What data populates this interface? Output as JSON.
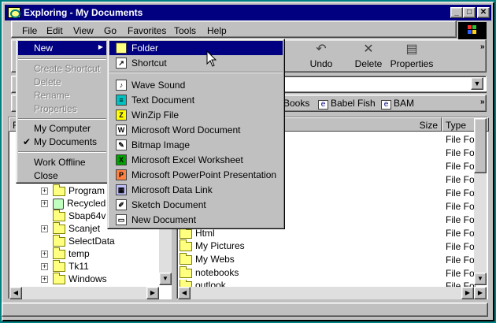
{
  "window": {
    "title": "Exploring - My Documents",
    "buttons": {
      "minimize": "_",
      "maximize": "□",
      "close": "✕"
    }
  },
  "menubar": [
    "File",
    "Edit",
    "View",
    "Go",
    "Favorites",
    "Tools",
    "Help"
  ],
  "toolbar": {
    "undo": "Undo",
    "delete": "Delete",
    "properties": "Properties"
  },
  "links": [
    "Books",
    "Babel Fish",
    "BAM"
  ],
  "columns": {
    "size": "Size",
    "type": "Type"
  },
  "file_menu": {
    "new": "New",
    "create_shortcut": "Create Shortcut",
    "delete": "Delete",
    "rename": "Rename",
    "properties": "Properties",
    "my_computer": "My Computer",
    "my_documents": "My Documents",
    "work_offline": "Work Offline",
    "close": "Close",
    "checkmark": "✔"
  },
  "new_submenu": [
    {
      "label": "Folder",
      "icon": "folder-icon"
    },
    {
      "label": "Shortcut",
      "icon": "shortcut-icon"
    },
    {
      "label": "Wave Sound",
      "icon": "wave-sound-icon"
    },
    {
      "label": "Text Document",
      "icon": "text-document-icon"
    },
    {
      "label": "WinZip File",
      "icon": "winzip-icon"
    },
    {
      "label": "Microsoft Word Document",
      "icon": "word-icon"
    },
    {
      "label": "Bitmap Image",
      "icon": "bitmap-icon"
    },
    {
      "label": "Microsoft Excel Worksheet",
      "icon": "excel-icon"
    },
    {
      "label": "Microsoft PowerPoint Presentation",
      "icon": "powerpoint-icon"
    },
    {
      "label": "Microsoft Data Link",
      "icon": "data-link-icon"
    },
    {
      "label": "Sketch Document",
      "icon": "sketch-icon"
    },
    {
      "label": "New Document",
      "icon": "new-document-icon"
    }
  ],
  "tree": [
    "Program F",
    "Recycled",
    "Sbap64v",
    "Scanjet",
    "SelectData",
    "temp",
    "Tk11",
    "Windows"
  ],
  "files": [
    "Html",
    "My Pictures",
    "My Webs",
    "notebooks",
    "outlook"
  ],
  "type_cells": [
    "File Folc",
    "File Folc",
    "File Folc",
    "File Folc",
    "File Folc",
    "File Folc",
    "File Folc",
    "File Folc",
    "File Folc",
    "File Folc",
    "File Folc",
    "File Folc"
  ],
  "pane_header_left": "F",
  "colors": {
    "title": "#000080",
    "face": "#c0c0c0",
    "desktop": "#008080"
  }
}
